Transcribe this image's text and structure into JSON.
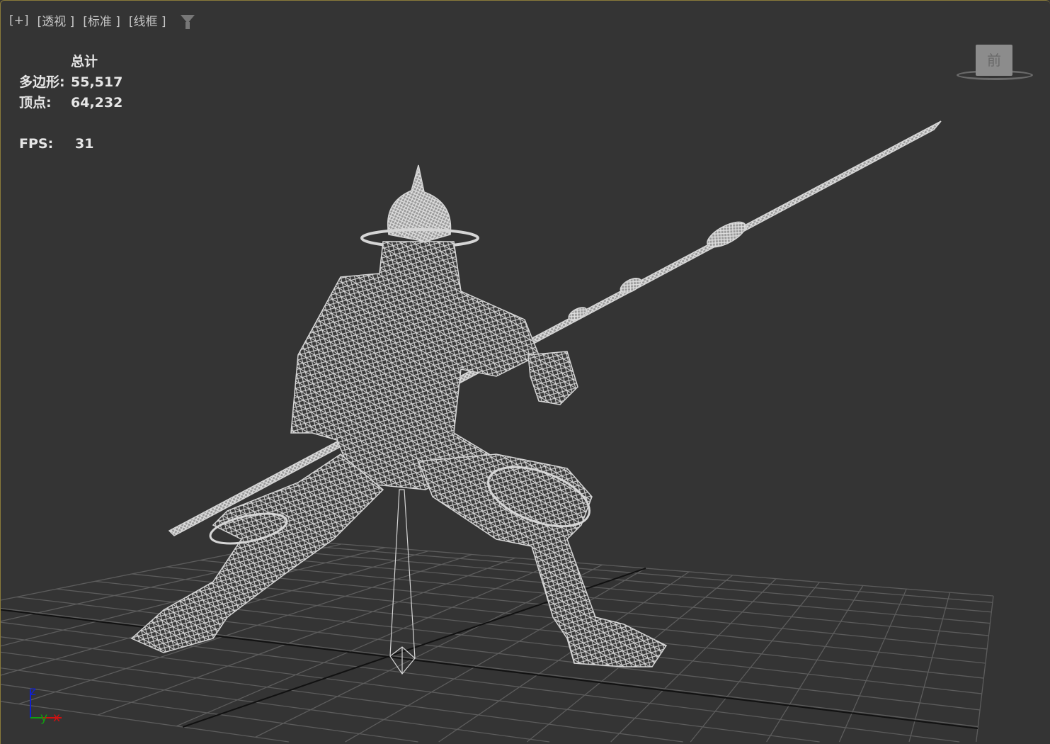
{
  "viewport": {
    "labels": [
      "[+]",
      "[透视 ]",
      "[标准 ]",
      "[线框 ]"
    ],
    "filter_icon": "filter-icon"
  },
  "stats": {
    "header": "总计",
    "polygons_label": "多边形:",
    "polygons_value": "55,517",
    "vertices_label": "顶点:",
    "vertices_value": "64,232",
    "fps_label": "FPS:",
    "fps_value": "31"
  },
  "viewcube": {
    "face": "前"
  },
  "axis_tripod": {
    "z": "z",
    "y": "y",
    "x": "x",
    "colors": {
      "x": "#d01010",
      "y": "#10a010",
      "z": "#1020d0"
    }
  },
  "colors": {
    "background": "#343434",
    "wire": "#d4d4d4",
    "grid": "#5a5a5a",
    "border": "#8a7a3a"
  }
}
